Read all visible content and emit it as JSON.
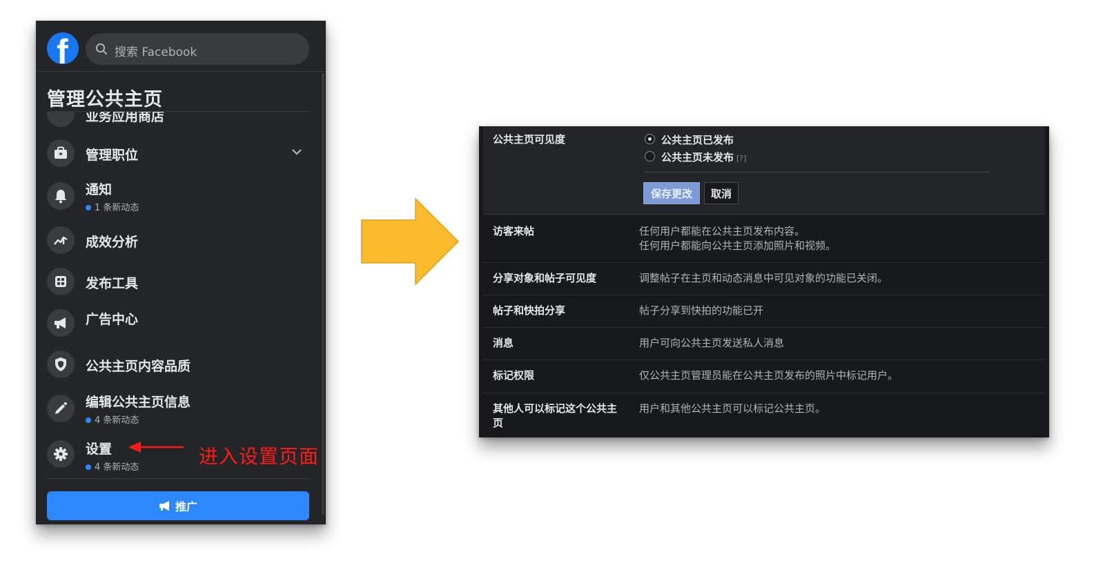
{
  "fb": {
    "logo_letter": "f",
    "search_placeholder": "搜索 Facebook",
    "heading": "管理公共主页",
    "cut_item_label": "业务应用商店",
    "items": [
      {
        "label": "管理职位",
        "icon": "briefcase-icon"
      },
      {
        "label": "通知",
        "sub": "1 条新动态",
        "icon": "bell-icon"
      },
      {
        "label": "成效分析",
        "icon": "chart-line-icon"
      },
      {
        "label": "发布工具",
        "icon": "calendar-grid-icon"
      },
      {
        "label": "广告中心",
        "icon": "megaphone-icon"
      },
      {
        "label": "公共主页内容品质",
        "icon": "shield-icon"
      },
      {
        "label": "编辑公共主页信息",
        "sub": "4 条新动态",
        "icon": "pencil-icon"
      },
      {
        "label": "设置",
        "sub": "4 条新动态",
        "icon": "gear-icon"
      }
    ],
    "promote_label": "推广"
  },
  "annotation": {
    "text": "进入设置页面",
    "color": "#ff1a1a"
  },
  "settings": {
    "visibility": {
      "label": "公共主页可见度",
      "options": [
        "公共主页已发布",
        "公共主页未发布"
      ],
      "selected": "公共主页已发布",
      "help": "[?]",
      "save_label": "保存更改",
      "cancel_label": "取消"
    },
    "rows": [
      {
        "label": "访客来帖",
        "value_lines": [
          "任何用户都能在公共主页发布内容。",
          "任何用户都能向公共主页添加照片和视频。"
        ]
      },
      {
        "label": "分享对象和帖子可见度",
        "value_lines": [
          "调整帖子在主页和动态消息中可见对象的功能已关闭。"
        ]
      },
      {
        "label": "帖子和快拍分享",
        "value_lines": [
          "帖子分享到快拍的功能已开"
        ]
      },
      {
        "label": "消息",
        "value_lines": [
          "用户可向公共主页发送私人消息"
        ]
      },
      {
        "label": "标记权限",
        "value_lines": [
          "仅公共主页管理员能在公共主页发布的照片中标记用户。"
        ]
      },
      {
        "label_lines": [
          "其他人可以标记这个公共主",
          "页"
        ],
        "value_lines": [
          "用户和其他公共主页可以标记公共主页。"
        ]
      }
    ]
  },
  "colors": {
    "fb_blue": "#1877f2",
    "promote_blue": "#2d88ff",
    "arrow_yellow": "#fbbb2c",
    "save_button": "#7b9ad6",
    "panel_bg": "#242526",
    "settings_bg": "#18191a"
  }
}
